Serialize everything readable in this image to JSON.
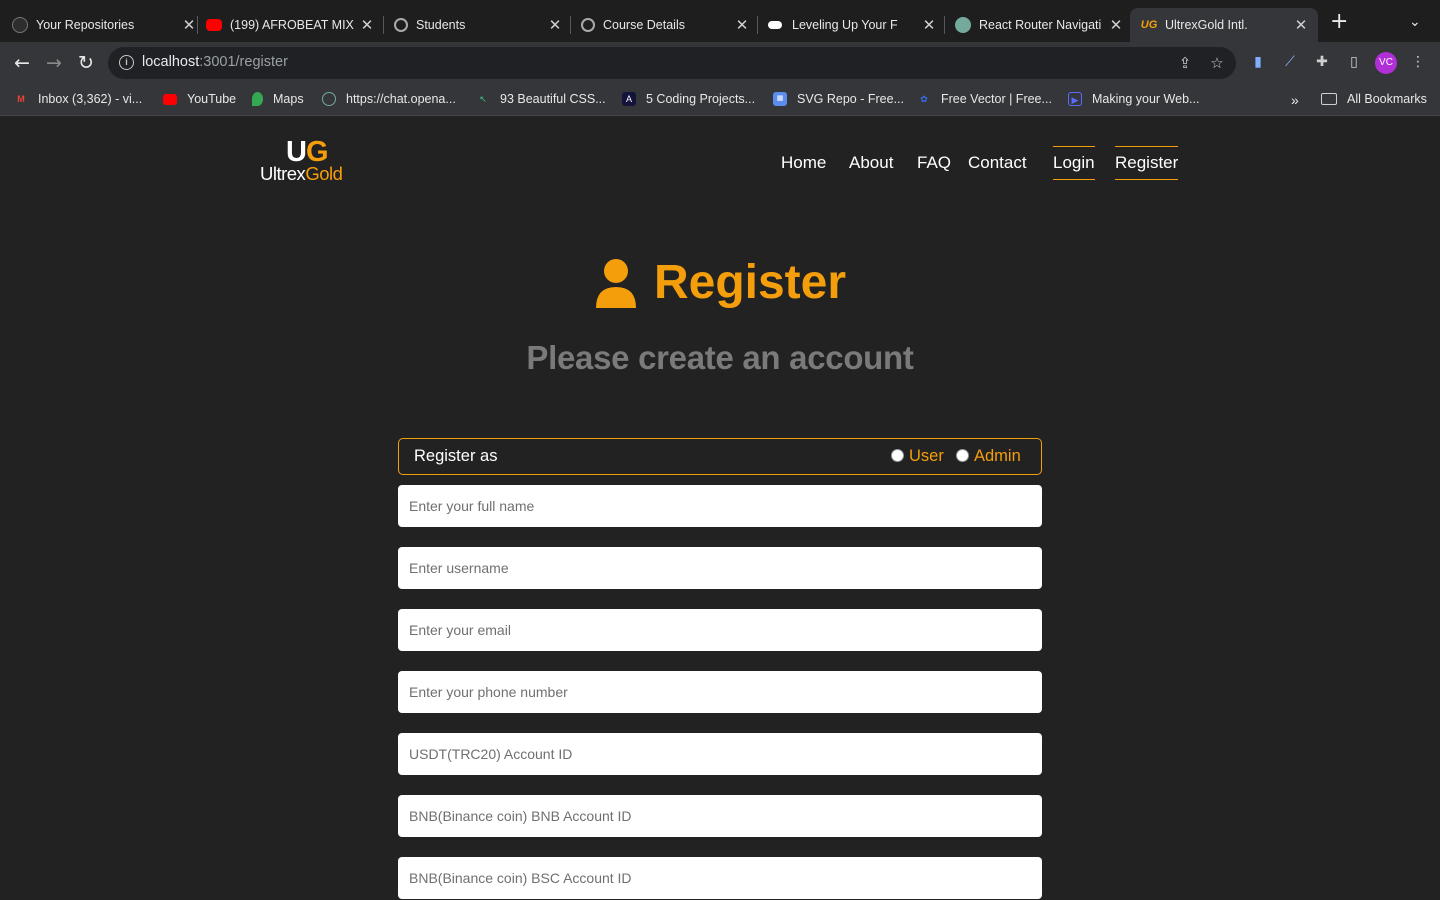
{
  "browser": {
    "tabs": [
      {
        "title": "Your Repositories",
        "icon": "github-icon"
      },
      {
        "title": "(199) AFROBEAT MIX",
        "icon": "youtube-icon"
      },
      {
        "title": "Students",
        "icon": "globe-icon"
      },
      {
        "title": "Course Details",
        "icon": "globe-icon"
      },
      {
        "title": "Leveling Up Your F",
        "icon": "medium-icon"
      },
      {
        "title": "React Router Navigati",
        "icon": "chatgpt-icon"
      },
      {
        "title": "UltrexGold Intl.",
        "icon": "ultrexgold-icon"
      }
    ],
    "url": {
      "host": "localhost",
      "path": ":3001/register"
    },
    "profile_initials": "VC",
    "bookmarks": [
      {
        "label": "Inbox (3,362) - vi...",
        "icon": "gmail-icon"
      },
      {
        "label": "YouTube",
        "icon": "youtube-icon"
      },
      {
        "label": "Maps",
        "icon": "maps-icon"
      },
      {
        "label": "https://chat.opena...",
        "icon": "chatgpt-icon"
      },
      {
        "label": "93 Beautiful CSS...",
        "icon": "cursor-icon"
      },
      {
        "label": "5 Coding Projects...",
        "icon": "angular-icon"
      },
      {
        "label": "SVG Repo - Free...",
        "icon": "svgrepo-icon"
      },
      {
        "label": "Free Vector | Free...",
        "icon": "freepik-icon"
      },
      {
        "label": "Making your Web...",
        "icon": "play-icon"
      }
    ],
    "bookmarks_overflow": "»",
    "all_bookmarks": "All Bookmarks"
  },
  "site": {
    "logo": {
      "initial_u": "U",
      "initial_g": "G",
      "word_1": "Ultrex",
      "word_2": "Gold"
    },
    "nav": [
      "Home",
      "About",
      "FAQ",
      "Contact",
      "Login",
      "Register"
    ],
    "heading": "Register",
    "subheading": "Please create an account",
    "role": {
      "label": "Register as",
      "options": [
        "User",
        "Admin"
      ]
    },
    "fields": [
      {
        "placeholder": "Enter your full name"
      },
      {
        "placeholder": "Enter username"
      },
      {
        "placeholder": "Enter your email"
      },
      {
        "placeholder": "Enter your phone number"
      },
      {
        "placeholder": "USDT(TRC20) Account ID"
      },
      {
        "placeholder": "BNB(Binance coin) BNB Account ID"
      },
      {
        "placeholder": "BNB(Binance coin) BSC Account ID"
      }
    ]
  },
  "colors": {
    "accent": "#f59e0b",
    "page_bg": "#222222",
    "muted_heading": "#7a7a7a"
  }
}
